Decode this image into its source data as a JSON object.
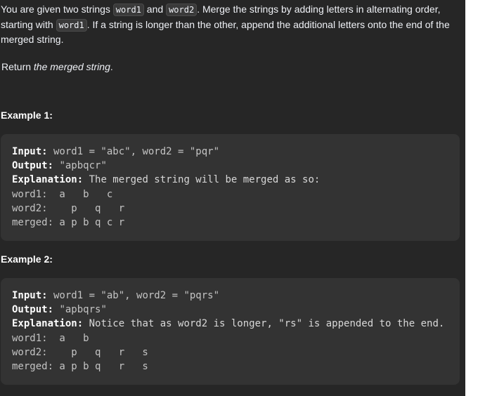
{
  "problem": {
    "intro_part1": "You are given two strings ",
    "word1_code": "word1",
    "and_text": " and ",
    "word2_code": "word2",
    "intro_part2": ". Merge the strings by adding letters in alternating order, starting with ",
    "starting_code": "word1",
    "intro_part3": ". If a string is longer than the other, append the additional letters onto the end of the merged string.",
    "return_prefix": "Return ",
    "return_emphasis": "the merged string",
    "return_suffix": "."
  },
  "examples": [
    {
      "title": "Example 1:",
      "input_label": "Input:",
      "input_value": " word1 = \"abc\", word2 = \"pqr\"",
      "output_label": "Output:",
      "output_value": " \"apbqcr\"",
      "explanation_label": "Explanation:",
      "explanation_value": " The merged string will be merged as so:",
      "diagram_word1": "word1:  a   b   c",
      "diagram_word2": "word2:    p   q   r",
      "diagram_merged": "merged: a p b q c r"
    },
    {
      "title": "Example 2:",
      "input_label": "Input:",
      "input_value": " word1 = \"ab\", word2 = \"pqrs\"",
      "output_label": "Output:",
      "output_value": " \"apbqrs\"",
      "explanation_label": "Explanation:",
      "explanation_value": " Notice that as word2 is longer, \"rs\" is appended to the end.",
      "diagram_word1": "word1:  a   b",
      "diagram_word2": "word2:    p   q   r   s",
      "diagram_merged": "merged: a p b q   r   s"
    }
  ]
}
